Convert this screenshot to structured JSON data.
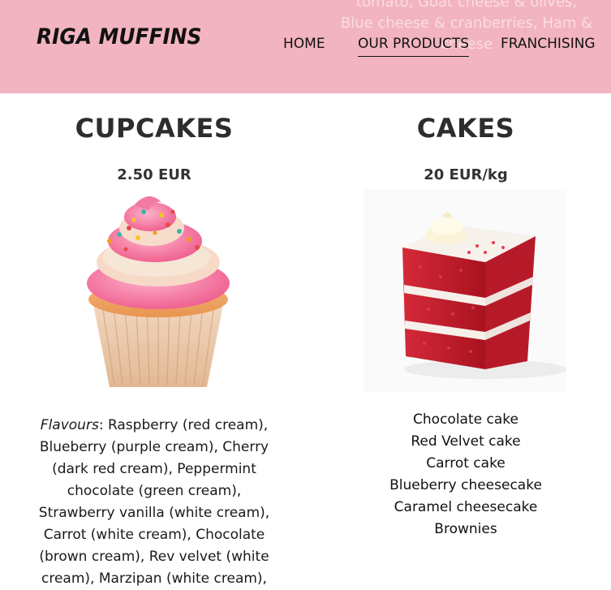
{
  "header": {
    "logo": "RIGA MUFFINS",
    "background_color": "#f2b4c0",
    "faded_lines": [
      "tomato, Goat cheese & olives,",
      "Blue cheese & cranberries, Ham &",
      "cheese"
    ],
    "nav": [
      {
        "label": "HOME",
        "active": false
      },
      {
        "label": "OUR PRODUCTS",
        "active": true
      },
      {
        "label": "FRANCHISING",
        "active": false
      }
    ]
  },
  "cupcakes": {
    "title": "CUPCAKES",
    "price": "2.50 EUR",
    "image_icon": "cupcake-image",
    "flavours_label": "Flavours",
    "flavours_text": ": Raspberry (red cream), Blueberry (purple cream), Cherry (dark red cream), Peppermint chocolate (green cream), Strawberry vanilla (white cream), Carrot (white cream), Chocolate (brown cream), Rev velvet (white cream), Marzipan (white cream),"
  },
  "cakes": {
    "title": "CAKES",
    "price": "20 EUR/kg",
    "image_icon": "red-velvet-cake-image",
    "items": [
      "Chocolate cake",
      "Red Velvet cake",
      "Carrot cake",
      "Blueberry cheesecake",
      "Caramel cheesecake",
      "Brownies"
    ]
  }
}
